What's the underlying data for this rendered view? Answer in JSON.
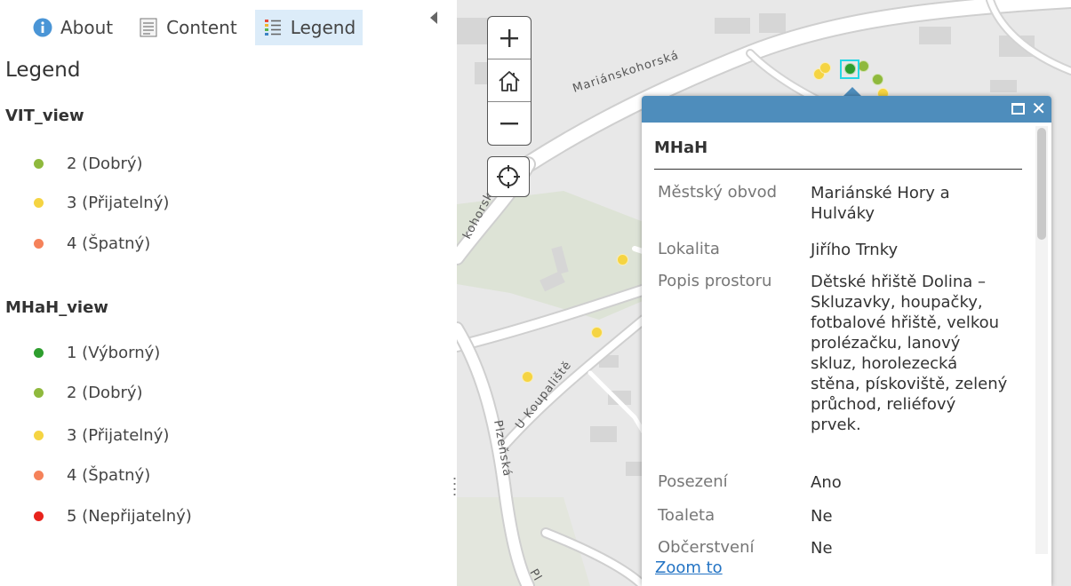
{
  "tabs": {
    "about": "About",
    "content": "Content",
    "legend": "Legend"
  },
  "legend": {
    "title": "Legend",
    "layers": [
      {
        "name": "VIT_view",
        "items": [
          {
            "label": "2 (Dobrý)",
            "color": "#8fb93d"
          },
          {
            "label": "3 (Přijatelný)",
            "color": "#f5d442"
          },
          {
            "label": "4 (Špatný)",
            "color": "#f5825a"
          }
        ]
      },
      {
        "name": "MHaH_view",
        "items": [
          {
            "label": "1 (Výborný)",
            "color": "#2e9e2e"
          },
          {
            "label": "2 (Dobrý)",
            "color": "#8fb93d"
          },
          {
            "label": "3 (Přijatelný)",
            "color": "#f5d442"
          },
          {
            "label": "4 (Špatný)",
            "color": "#f5825a"
          },
          {
            "label": "5 (Nepřijatelný)",
            "color": "#e8231c"
          }
        ]
      }
    ]
  },
  "map": {
    "streets": {
      "marianskohorska": "Mariánskohorská",
      "koohorska": "kohorská",
      "u_koupaliste": "U Koupaliště",
      "plzenska": "Plzeňská",
      "pl": "Pl"
    },
    "controls": {
      "zoom_in": "+",
      "zoom_out": "−"
    }
  },
  "popup": {
    "title": "MHaH",
    "attributes": [
      {
        "name": "Městský obvod",
        "value_lines": [
          "Mariánské Hory a",
          "Hulváky"
        ]
      },
      {
        "name": "Lokalita",
        "value_lines": [
          "Jiřího Trnky"
        ]
      },
      {
        "name": "Popis prostoru",
        "value_lines": [
          "Dětské hřiště Dolina –",
          "Skluzavky, houpačky,",
          "fotbalové hřiště, velkou",
          "prolézačku, lanový",
          "skluz, horolezecká",
          "stěna, pískoviště, zelený",
          "průchod, reliéfový",
          "prvek."
        ]
      },
      {
        "name": "Posezení",
        "value_lines": [
          "Ano"
        ]
      },
      {
        "name": "Toaleta",
        "value_lines": [
          "Ne"
        ]
      },
      {
        "name": "Občerstvení",
        "value_lines": [
          "Ne"
        ]
      }
    ],
    "zoom_to": "Zoom to",
    "header_color": "#4e8dbc"
  }
}
